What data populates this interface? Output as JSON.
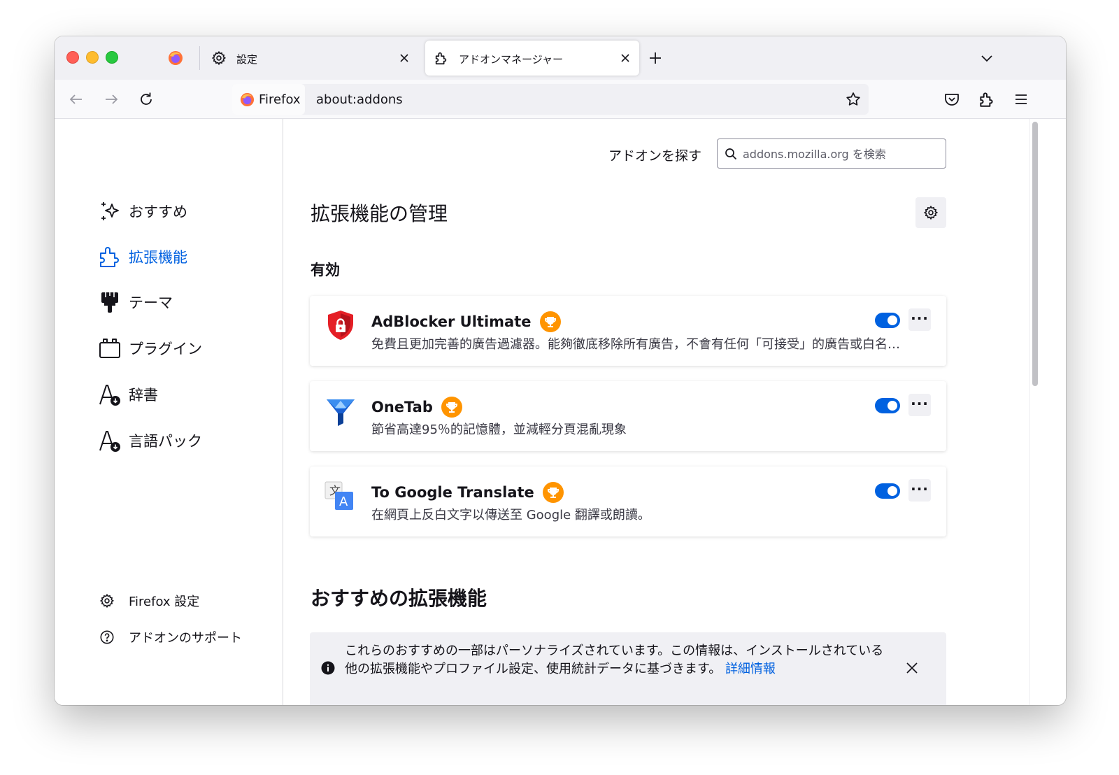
{
  "browser": {
    "tabs": [
      {
        "label": "設定",
        "icon": "gear-icon",
        "active": false
      },
      {
        "label": "アドオンマネージャー",
        "icon": "puzzle-icon",
        "active": true
      }
    ],
    "url_identity": "Firefox",
    "url": "about:addons"
  },
  "sidebar": {
    "categories": [
      {
        "label": "おすすめ",
        "icon": "sparkle-icon",
        "selected": false
      },
      {
        "label": "拡張機能",
        "icon": "puzzle-icon",
        "selected": true
      },
      {
        "label": "テーマ",
        "icon": "paintbrush-icon",
        "selected": false
      },
      {
        "label": "プラグイン",
        "icon": "plugin-icon",
        "selected": false
      },
      {
        "label": "辞書",
        "icon": "dictionary-icon",
        "selected": false
      },
      {
        "label": "言語パック",
        "icon": "language-pack-icon",
        "selected": false
      }
    ],
    "footer": [
      {
        "label": "Firefox 設定",
        "icon": "gear-icon"
      },
      {
        "label": "アドオンのサポート",
        "icon": "help-icon"
      }
    ]
  },
  "main": {
    "search_label": "アドオンを探す",
    "search_placeholder": "addons.mozilla.org を検索",
    "page_title": "拡張機能の管理",
    "enabled_heading": "有効",
    "extensions": [
      {
        "name": "AdBlocker Ultimate",
        "description": "免費且更加完善的廣告過濾器。能夠徹底移除所有廣告，不會有任何「可接受」的廣告或白名單。",
        "enabled": true,
        "recommended": true
      },
      {
        "name": "OneTab",
        "description": "節省高達95％的記憶體，並減輕分頁混亂現象",
        "enabled": true,
        "recommended": true
      },
      {
        "name": "To Google Translate",
        "description": "在網頁上反白文字以傳送至 Google 翻譯或朗讀。",
        "enabled": true,
        "recommended": true
      }
    ],
    "more_label": "···",
    "recommended_heading": "おすすめの拡張機能",
    "message": {
      "text": "これらのおすすめの一部はパーソナライズされています。この情報は、インストールされている他の拡張機能やプロファイル設定、使用統計データに基づきます。",
      "link": "詳細情報"
    }
  },
  "colors": {
    "accent": "#0061e0",
    "badge": "#ff9400",
    "chrome": "#f0f0f4"
  }
}
